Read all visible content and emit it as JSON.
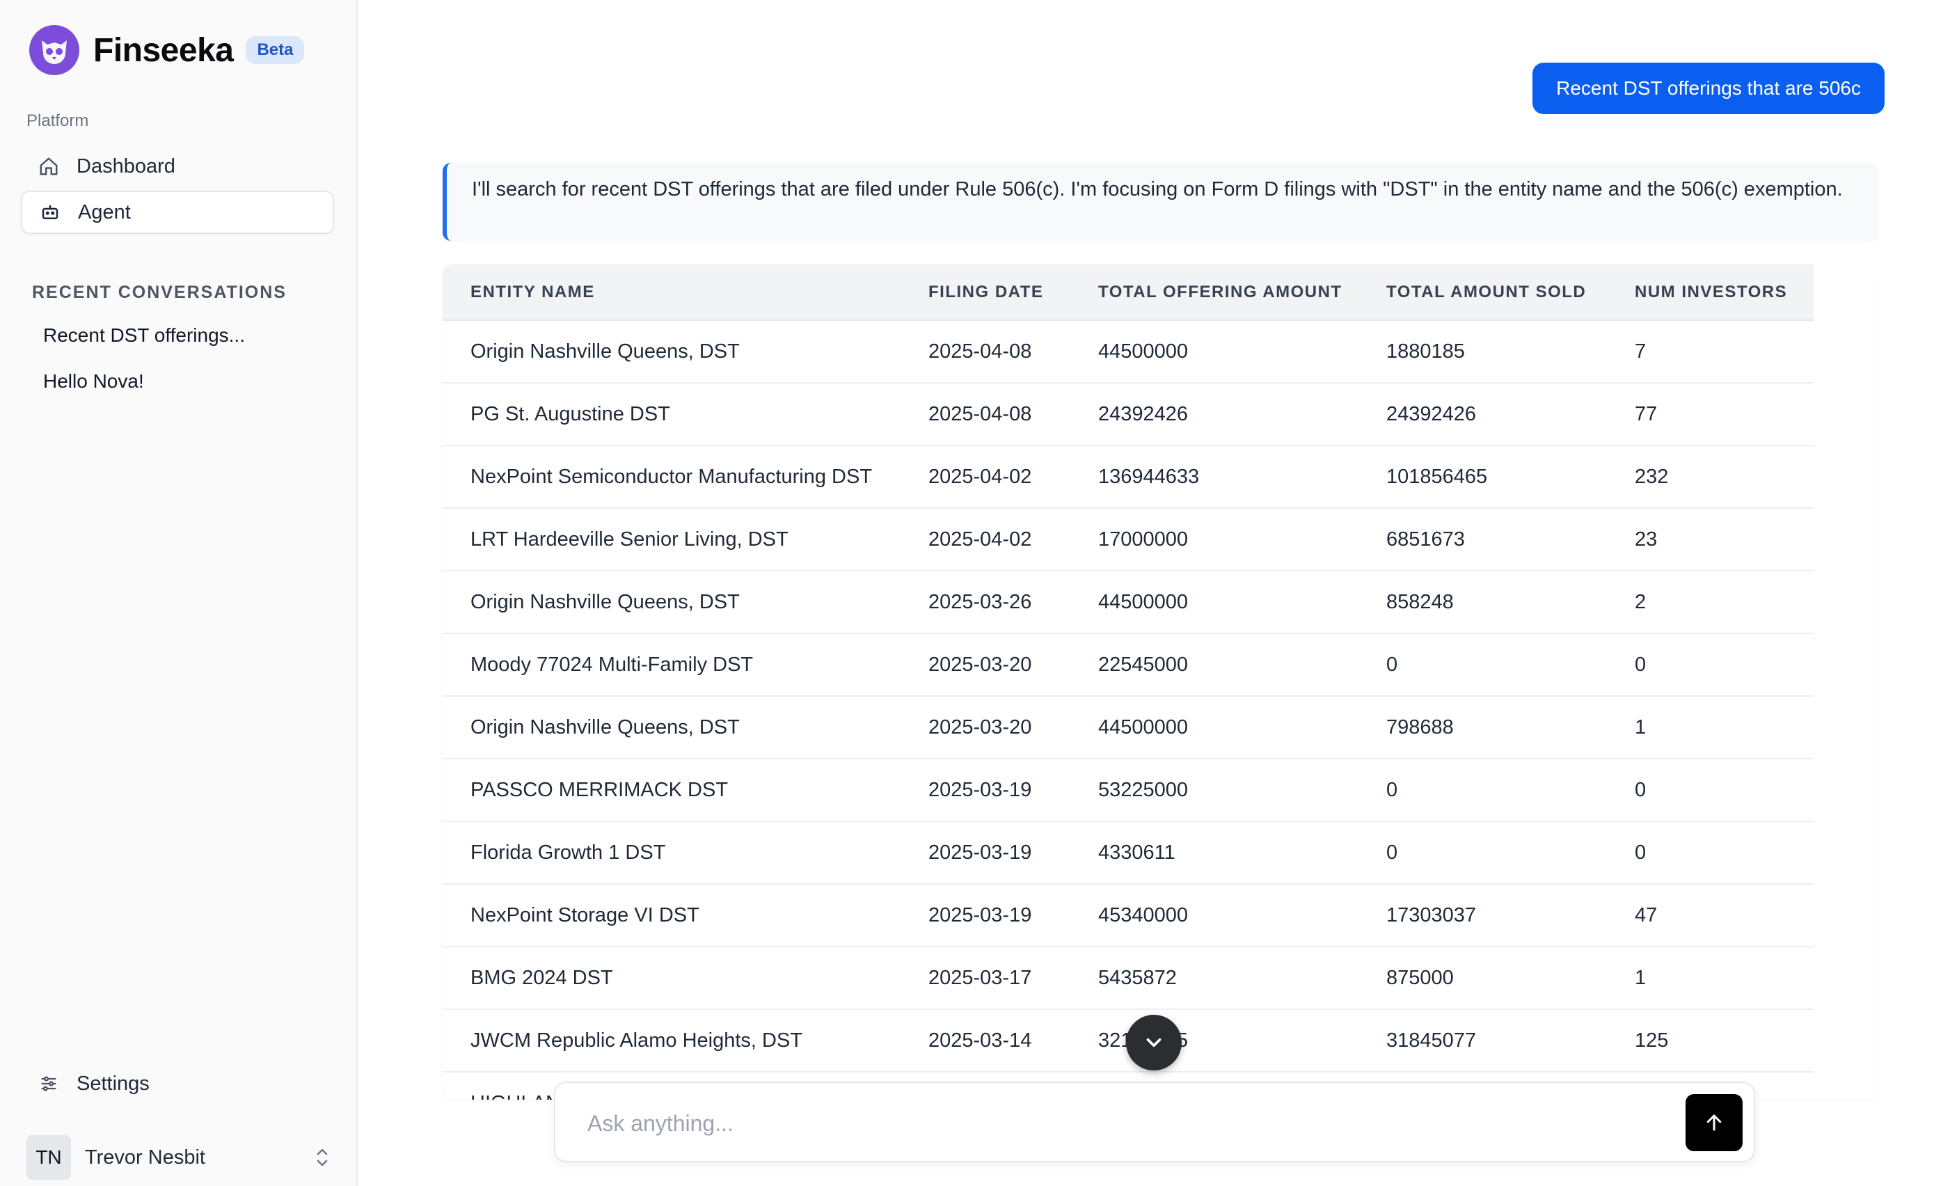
{
  "brand": {
    "name": "Finseeka",
    "badge": "Beta"
  },
  "sidebar": {
    "section_label": "Platform",
    "nav": [
      {
        "label": "Dashboard",
        "icon": "home-icon"
      },
      {
        "label": "Agent",
        "icon": "robot-icon",
        "active": true
      }
    ],
    "recent_title": "RECENT CONVERSATIONS",
    "recent": [
      "Recent DST offerings...",
      "Hello Nova!"
    ],
    "settings_label": "Settings",
    "user": {
      "initials": "TN",
      "name": "Trevor Nesbit"
    }
  },
  "chat": {
    "user_message": "Recent DST offerings that are 506c",
    "assistant_message": "I'll search for recent DST offerings that are filed under Rule 506(c). I'm focusing on Form D filings with \"DST\" in the entity name and the 506(c) exemption.",
    "table": {
      "headers": [
        "ENTITY NAME",
        "FILING DATE",
        "TOTAL OFFERING AMOUNT",
        "TOTAL AMOUNT SOLD",
        "NUM INVESTORS"
      ],
      "rows": [
        [
          "Origin Nashville Queens, DST",
          "2025-04-08",
          "44500000",
          "1880185",
          "7"
        ],
        [
          "PG St. Augustine DST",
          "2025-04-08",
          "24392426",
          "24392426",
          "77"
        ],
        [
          "NexPoint Semiconductor Manufacturing DST",
          "2025-04-02",
          "136944633",
          "101856465",
          "232"
        ],
        [
          "LRT Hardeeville Senior Living, DST",
          "2025-04-02",
          "17000000",
          "6851673",
          "23"
        ],
        [
          "Origin Nashville Queens, DST",
          "2025-03-26",
          "44500000",
          "858248",
          "2"
        ],
        [
          "Moody 77024 Multi-Family DST",
          "2025-03-20",
          "22545000",
          "0",
          "0"
        ],
        [
          "Origin Nashville Queens, DST",
          "2025-03-20",
          "44500000",
          "798688",
          "1"
        ],
        [
          "PASSCO MERRIMACK DST",
          "2025-03-19",
          "53225000",
          "0",
          "0"
        ],
        [
          "Florida Growth 1 DST",
          "2025-03-19",
          "4330611",
          "0",
          "0"
        ],
        [
          "NexPoint Storage VI DST",
          "2025-03-19",
          "45340000",
          "17303037",
          "47"
        ],
        [
          "BMG 2024 DST",
          "2025-03-17",
          "5435872",
          "875000",
          "1"
        ],
        [
          "JWCM Republic Alamo Heights, DST",
          "2025-03-14",
          "32185245",
          "31845077",
          "125"
        ]
      ],
      "partial_row_text": "HIGHLAN"
    },
    "composer": {
      "placeholder": "Ask anything..."
    }
  },
  "colors": {
    "accent": "#0b5ff0",
    "logo": "#7c4ddb",
    "assistant_border": "#1f6feb"
  }
}
